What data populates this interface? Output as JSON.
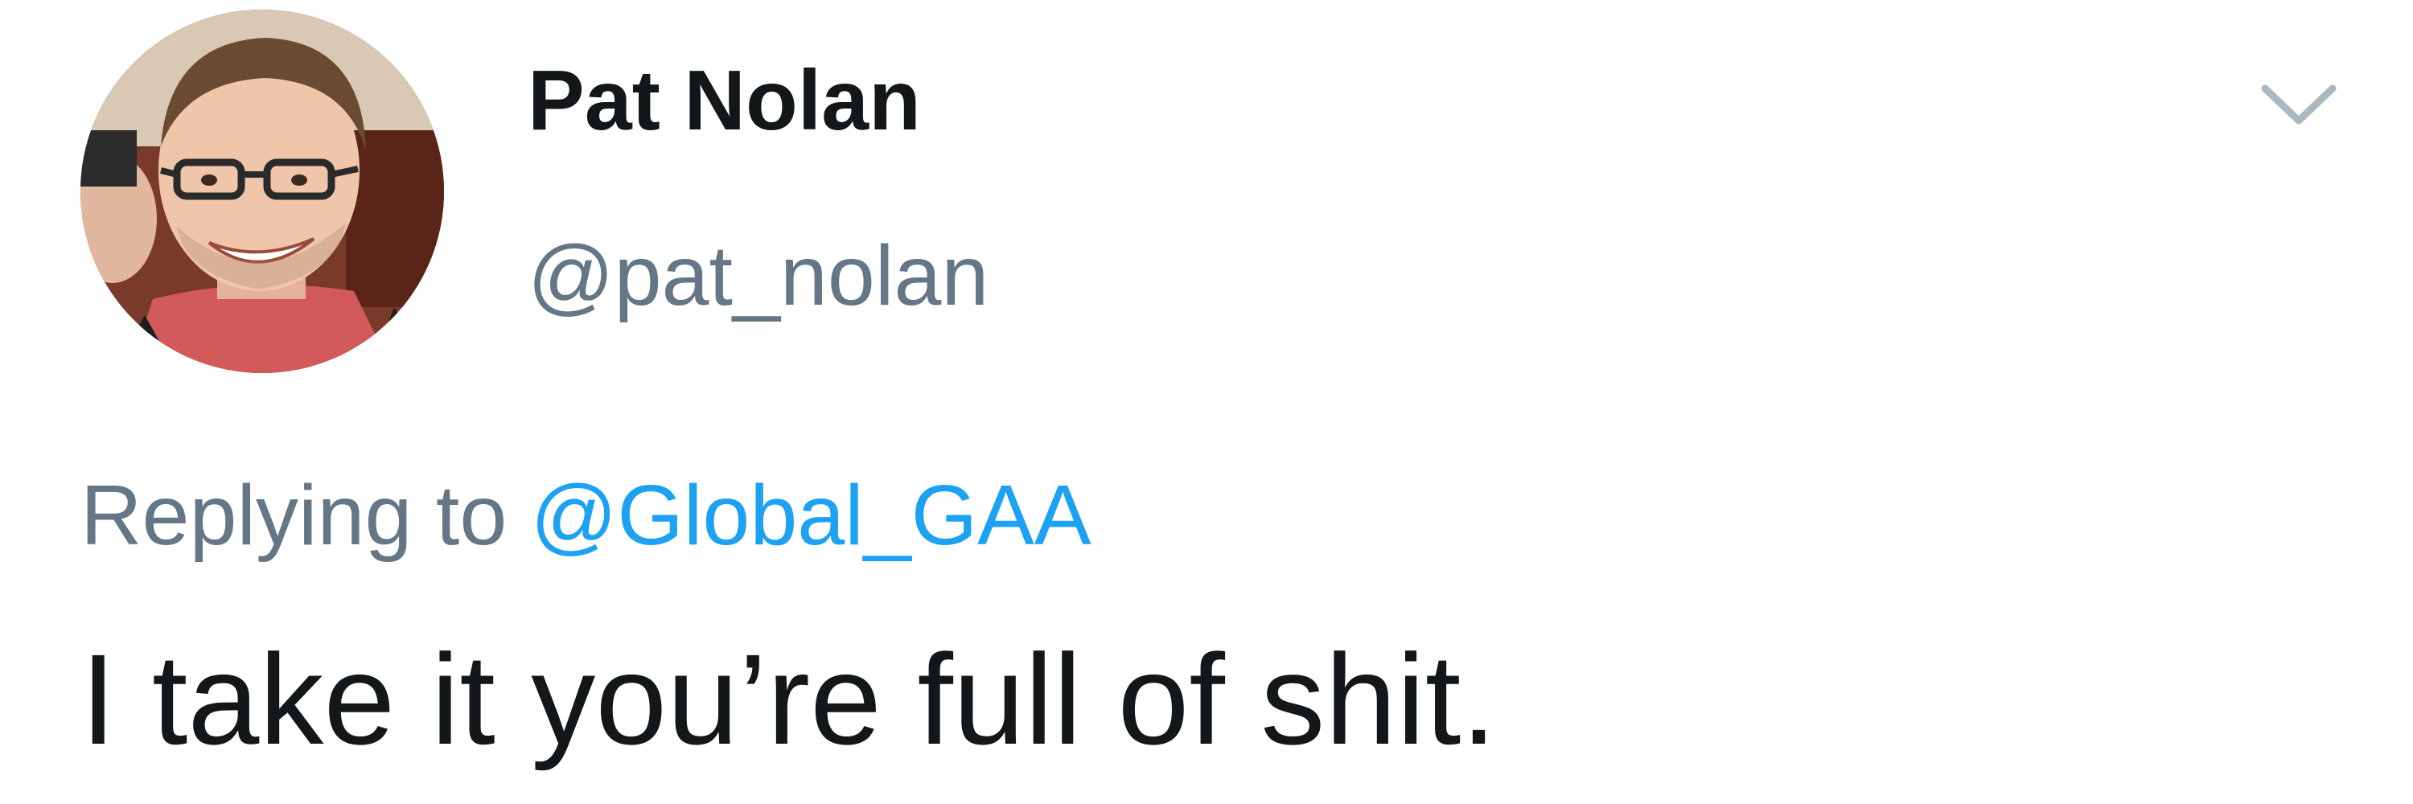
{
  "tweet": {
    "author": {
      "display_name": "Pat Nolan",
      "handle": "@pat_nolan",
      "avatar_icon": "avatar-photo"
    },
    "reply": {
      "prefix": "Replying to",
      "mention": "@Global_GAA"
    },
    "text": "I take it you’re full of shit.",
    "menu_icon": "chevron-down-icon"
  },
  "colors": {
    "primary_text": "#14171a",
    "secondary_text": "#657786",
    "link": "#1da1f2",
    "background": "#ffffff"
  }
}
